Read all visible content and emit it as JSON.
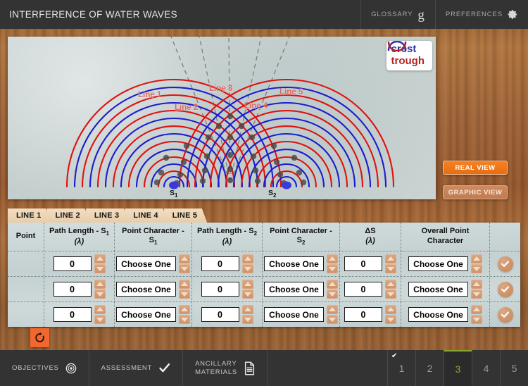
{
  "header": {
    "title": "INTERFERENCE OF WATER WAVES",
    "glossary_label": "GLOSSARY",
    "glossary_icon": "glossary-g-icon",
    "preferences_label": "PREFERENCES",
    "preferences_icon": "gear-icon"
  },
  "simulation": {
    "line_labels": [
      "Line 1",
      "Line 2",
      "Line 3",
      "Line 4",
      "Line 5"
    ],
    "source_labels": [
      "S",
      "S"
    ],
    "source_subscripts": [
      "1",
      "2"
    ],
    "legend": {
      "crest_label": "crest",
      "trough_label": "trough",
      "crest_color": "#3333a8",
      "trough_color": "#b32222"
    },
    "label_color": "#e3685c"
  },
  "view_buttons": {
    "real": {
      "label": "REAL VIEW",
      "active": true,
      "color": "#f58220"
    },
    "graphic": {
      "label": "GRAPHIC VIEW",
      "active": false,
      "color": "#c07b50"
    }
  },
  "tabs": [
    {
      "label": "LINE 1"
    },
    {
      "label": "LINE 2"
    },
    {
      "label": "LINE 3"
    },
    {
      "label": "LINE 4"
    },
    {
      "label": "LINE 5"
    }
  ],
  "table": {
    "headers": {
      "point": "Point",
      "path_length_s1": "Path Length - S",
      "path_length_s1_sub": "1",
      "path_length_unit": "(λ)",
      "point_character_s1": "Point Character - S",
      "point_character_s1_sub": "1",
      "path_length_s2": "Path Length - S",
      "path_length_s2_sub": "2",
      "point_character_s2": "Point Character - S",
      "point_character_s2_sub": "2",
      "delta_s": "ΔS",
      "delta_s_unit": "(λ)",
      "overall_point_character_l1": "Overall Point",
      "overall_point_character_l2": "Character"
    },
    "rows": [
      {
        "point": "",
        "path_length_s1": "0",
        "point_character_s1": "Choose One",
        "path_length_s2": "0",
        "point_character_s2": "Choose One",
        "delta_s": "0",
        "overall_point_character": "Choose One"
      },
      {
        "point": "",
        "path_length_s1": "0",
        "point_character_s1": "Choose One",
        "path_length_s2": "0",
        "point_character_s2": "Choose One",
        "delta_s": "0",
        "overall_point_character": "Choose One"
      },
      {
        "point": "",
        "path_length_s1": "0",
        "point_character_s1": "Choose One",
        "path_length_s2": "0",
        "point_character_s2": "Choose One",
        "delta_s": "0",
        "overall_point_character": "Choose One"
      }
    ],
    "check_icon": "check-icon",
    "spinner_up_icon": "caret-up-icon",
    "spinner_down_icon": "caret-down-icon"
  },
  "reset_button": {
    "icon": "reset-circular-arrow-icon",
    "color": "#f2672e"
  },
  "bottom": {
    "objectives_label": "OBJECTIVES",
    "objectives_icon": "target-icon",
    "assessment_label": "ASSESSMENT",
    "assessment_icon": "check-icon",
    "ancillary_label_l1": "ANCILLARY",
    "ancillary_label_l2": "MATERIALS",
    "ancillary_icon": "document-icon",
    "pages": [
      {
        "num": "1",
        "active": false,
        "completed": true
      },
      {
        "num": "2",
        "active": false,
        "completed": false
      },
      {
        "num": "3",
        "active": true,
        "completed": false
      },
      {
        "num": "4",
        "active": false,
        "completed": false
      },
      {
        "num": "5",
        "active": false,
        "completed": false
      }
    ],
    "completed_mark": "✔",
    "active_color": "#8aa832"
  }
}
